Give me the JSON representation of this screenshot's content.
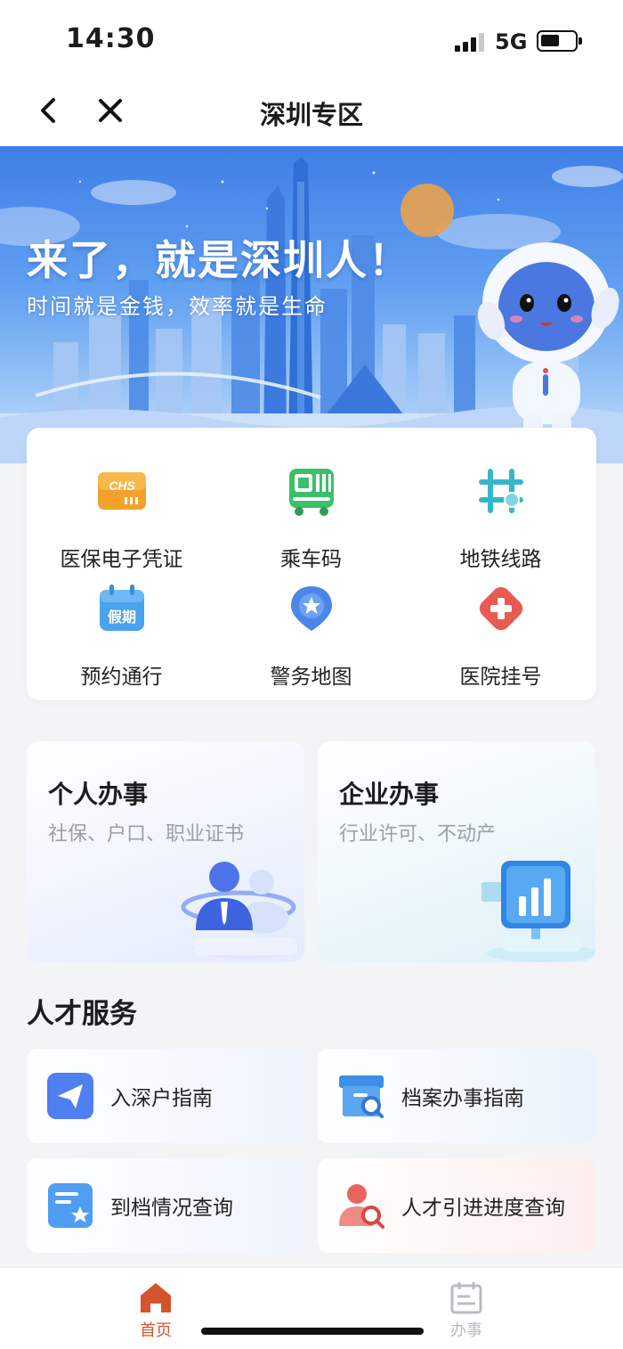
{
  "status_bar": {
    "time": "14:30",
    "network": "5G"
  },
  "nav": {
    "title": "深圳专区"
  },
  "banner": {
    "title": "来了，就是深圳人！",
    "subtitle": "时间就是金钱，效率就是生命",
    "icon_badge_text": "CHS"
  },
  "quick_services": [
    {
      "label": "医保电子凭证",
      "icon": "chs-card-icon",
      "badge": "CHS"
    },
    {
      "label": "乘车码",
      "icon": "bus-qr-icon"
    },
    {
      "label": "地铁线路",
      "icon": "metro-route-icon"
    },
    {
      "label": "预约通行",
      "icon": "holiday-calendar-icon",
      "badge": "假期"
    },
    {
      "label": "警务地图",
      "icon": "police-map-pin-icon"
    },
    {
      "label": "医院挂号",
      "icon": "hospital-cross-icon"
    }
  ],
  "categories": {
    "personal": {
      "title": "个人办事",
      "subtitle": "社保、户口、职业证书"
    },
    "enterprise": {
      "title": "企业办事",
      "subtitle": "行业许可、不动产"
    }
  },
  "talent_section": {
    "title": "人才服务",
    "items": [
      {
        "label": "入深户指南",
        "icon": "paper-plane-icon"
      },
      {
        "label": "档案办事指南",
        "icon": "archive-search-icon"
      },
      {
        "label": "到档情况查询",
        "icon": "file-star-icon"
      },
      {
        "label": "人才引进进度查询",
        "icon": "person-search-icon"
      }
    ]
  },
  "tab_bar": {
    "items": [
      {
        "label": "首页",
        "icon": "home-icon",
        "active": true
      },
      {
        "label": "办事",
        "icon": "calendar-tasks-icon",
        "active": false
      }
    ]
  },
  "colors": {
    "accent": "#d4542d",
    "primary_blue": "#3f7fe6",
    "inactive": "#b8bcc2",
    "background": "#f3f4f6"
  }
}
